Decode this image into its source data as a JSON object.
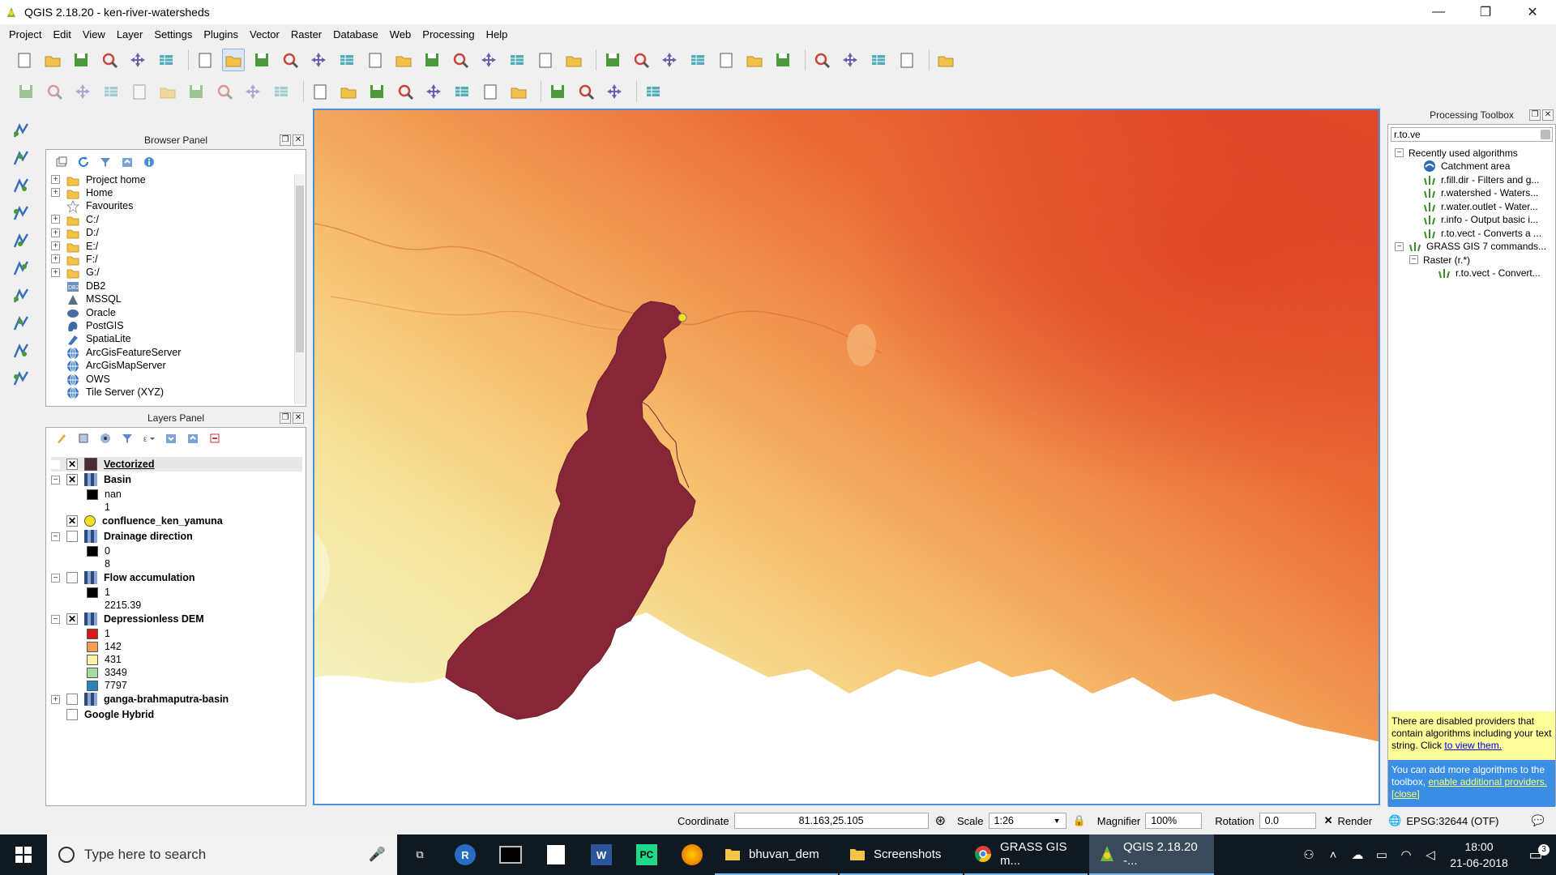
{
  "window": {
    "title": "QGIS 2.18.20 - ken-river-watersheds",
    "minimize": "—",
    "restore": "❐",
    "close": "✕"
  },
  "menu": [
    "Project",
    "Edit",
    "View",
    "Layer",
    "Settings",
    "Plugins",
    "Vector",
    "Raster",
    "Database",
    "Web",
    "Processing",
    "Help"
  ],
  "toolbar1_icons": [
    "new-project-icon",
    "open-project-icon",
    "save-project-icon",
    "save-as-icon",
    "print-composer-icon",
    "composer-manager-icon",
    "touch-zoom-icon",
    "pan-icon",
    "pan-to-selection-icon",
    "zoom-in-icon",
    "zoom-out-icon",
    "zoom-native-icon",
    "zoom-full-icon",
    "zoom-to-selection-icon",
    "zoom-to-layer-icon",
    "zoom-last-icon",
    "zoom-next-icon",
    "new-bookmark-icon",
    "show-bookmarks-icon",
    "refresh-icon",
    "identify-icon",
    "run-action-icon",
    "select-features-icon",
    "select-by-value-icon",
    "deselect-icon",
    "attribute-table-icon",
    "field-calculator-icon",
    "statistics-icon",
    "measure-icon",
    "map-tips-icon",
    "text-annotation-icon",
    "help-icon"
  ],
  "toolbar2_icons": [
    "toggle-editing-icon",
    "current-edits-icon",
    "save-edits-icon",
    "add-feature-icon",
    "move-feature-icon",
    "node-tool-icon",
    "delete-selected-icon",
    "cut-features-icon",
    "copy-features-icon",
    "paste-features-icon",
    "label-toolbar-icon",
    "layer-diagram-icon",
    "pin-labels-icon",
    "show-labels-icon",
    "move-label-icon",
    "rotate-label-icon",
    "change-label-icon",
    "show-hide-labels-icon",
    "wms-icon",
    "wfs-icon",
    "csv-icon",
    "python-console-icon"
  ],
  "browser_panel": {
    "title": "Browser Panel",
    "items": [
      {
        "label": "Project home",
        "icon": "folder-icon",
        "exp": "+"
      },
      {
        "label": "Home",
        "icon": "folder-icon",
        "exp": "+"
      },
      {
        "label": "Favourites",
        "icon": "star-icon",
        "exp": ""
      },
      {
        "label": "C:/",
        "icon": "folder-icon",
        "exp": "+"
      },
      {
        "label": "D:/",
        "icon": "folder-icon",
        "exp": "+"
      },
      {
        "label": "E:/",
        "icon": "folder-icon",
        "exp": "+"
      },
      {
        "label": "F:/",
        "icon": "folder-icon",
        "exp": "+"
      },
      {
        "label": "G:/",
        "icon": "folder-icon",
        "exp": "+"
      },
      {
        "label": "DB2",
        "icon": "db2-icon",
        "exp": ""
      },
      {
        "label": "MSSQL",
        "icon": "mssql-icon",
        "exp": ""
      },
      {
        "label": "Oracle",
        "icon": "oracle-icon",
        "exp": ""
      },
      {
        "label": "PostGIS",
        "icon": "postgis-icon",
        "exp": ""
      },
      {
        "label": "SpatiaLite",
        "icon": "spatialite-icon",
        "exp": ""
      },
      {
        "label": "ArcGisFeatureServer",
        "icon": "globe-icon",
        "exp": ""
      },
      {
        "label": "ArcGisMapServer",
        "icon": "globe-icon",
        "exp": ""
      },
      {
        "label": "OWS",
        "icon": "globe-icon",
        "exp": ""
      },
      {
        "label": "Tile Server (XYZ)",
        "icon": "globe-icon",
        "exp": ""
      }
    ]
  },
  "layers_panel": {
    "title": "Layers Panel",
    "rows": [
      {
        "type": "layer",
        "checked": true,
        "icon": "vector-fill",
        "color": "#4b2a3a",
        "label": "Vectorized",
        "exp": ""
      },
      {
        "type": "layer",
        "checked": true,
        "icon": "raster",
        "label": "Basin",
        "exp": "−"
      },
      {
        "type": "legend",
        "color": "#000000",
        "label": "nan"
      },
      {
        "type": "legend",
        "color": "",
        "label": "1"
      },
      {
        "type": "layer",
        "checked": true,
        "icon": "point",
        "color": "#f2e21c",
        "label": "confluence_ken_yamuna",
        "exp": ""
      },
      {
        "type": "layer",
        "checked": false,
        "icon": "raster",
        "label": "Drainage direction",
        "exp": "−"
      },
      {
        "type": "legend",
        "color": "#000000",
        "label": "0"
      },
      {
        "type": "legend",
        "color": "",
        "label": "8"
      },
      {
        "type": "layer",
        "checked": false,
        "icon": "raster",
        "label": "Flow accumulation",
        "exp": "−"
      },
      {
        "type": "legend",
        "color": "#000000",
        "label": "1"
      },
      {
        "type": "legend",
        "color": "",
        "label": "2215.39"
      },
      {
        "type": "layer",
        "checked": true,
        "icon": "raster",
        "label": "Depressionless DEM",
        "exp": "−"
      },
      {
        "type": "legend",
        "color": "#d7191c",
        "label": "1"
      },
      {
        "type": "legend",
        "color": "#f59c55",
        "label": "142"
      },
      {
        "type": "legend",
        "color": "#fff3a8",
        "label": "431"
      },
      {
        "type": "legend",
        "color": "#a6dba0",
        "label": "3349"
      },
      {
        "type": "legend",
        "color": "#2b83ba",
        "label": "7797"
      },
      {
        "type": "layer",
        "checked": false,
        "icon": "raster",
        "label": "ganga-brahmaputra-basin",
        "exp": "+"
      },
      {
        "type": "layer",
        "checked": false,
        "icon": "none",
        "label": "Google Hybrid",
        "exp": ""
      }
    ]
  },
  "toolbox": {
    "title": "Processing Toolbox",
    "search": "r.to.ve",
    "tree": [
      {
        "level": 0,
        "exp": "−",
        "icon": "",
        "label": "Recently used algorithms"
      },
      {
        "level": 1,
        "exp": "",
        "icon": "catchment-icon",
        "label": "Catchment area"
      },
      {
        "level": 1,
        "exp": "",
        "icon": "grass-icon",
        "label": "r.fill.dir - Filters and g..."
      },
      {
        "level": 1,
        "exp": "",
        "icon": "grass-icon",
        "label": "r.watershed - Waters..."
      },
      {
        "level": 1,
        "exp": "",
        "icon": "grass-icon",
        "label": "r.water.outlet - Water..."
      },
      {
        "level": 1,
        "exp": "",
        "icon": "grass-icon",
        "label": "r.info - Output basic i..."
      },
      {
        "level": 1,
        "exp": "",
        "icon": "grass-icon",
        "label": "r.to.vect - Converts a ..."
      },
      {
        "level": 0,
        "exp": "−",
        "icon": "grass-icon",
        "label": "GRASS GIS 7 commands..."
      },
      {
        "level": 1,
        "exp": "−",
        "icon": "",
        "label": "Raster (r.*)"
      },
      {
        "level": 2,
        "exp": "",
        "icon": "grass-icon",
        "label": "r.to.vect - Convert..."
      }
    ],
    "warning": "There are disabled providers that contain algorithms including your text string. Click",
    "warning_link": "to view them.",
    "info": "You can add more algorithms to the toolbox,",
    "info_link": "enable additional providers.",
    "info_close": "[close]"
  },
  "status": {
    "coordinate_label": "Coordinate",
    "coordinate": "81.163,25.105",
    "scale_label": "Scale",
    "scale": "1:26",
    "magnifier_label": "Magnifier",
    "magnifier": "100%",
    "rotation_label": "Rotation",
    "rotation": "0.0",
    "render_label": "Render",
    "crs": "EPSG:32644 (OTF)"
  },
  "taskbar": {
    "search_placeholder": "Type here to search",
    "apps": [
      {
        "label": "bhuvan_dem",
        "icon": "folder-icon"
      },
      {
        "label": "Screenshots",
        "icon": "folder-icon"
      },
      {
        "label": "GRASS GIS m...",
        "icon": "chrome-icon"
      },
      {
        "label": "QGIS 2.18.20 -...",
        "icon": "qgis-icon"
      }
    ],
    "time": "18:00",
    "date": "21-06-2018",
    "notifications": "3"
  },
  "colors": {
    "basin_fill": "#862636",
    "accent": "#4a90e2",
    "dem_high": "#e04a2a",
    "dem_low": "#f4f3c0"
  }
}
